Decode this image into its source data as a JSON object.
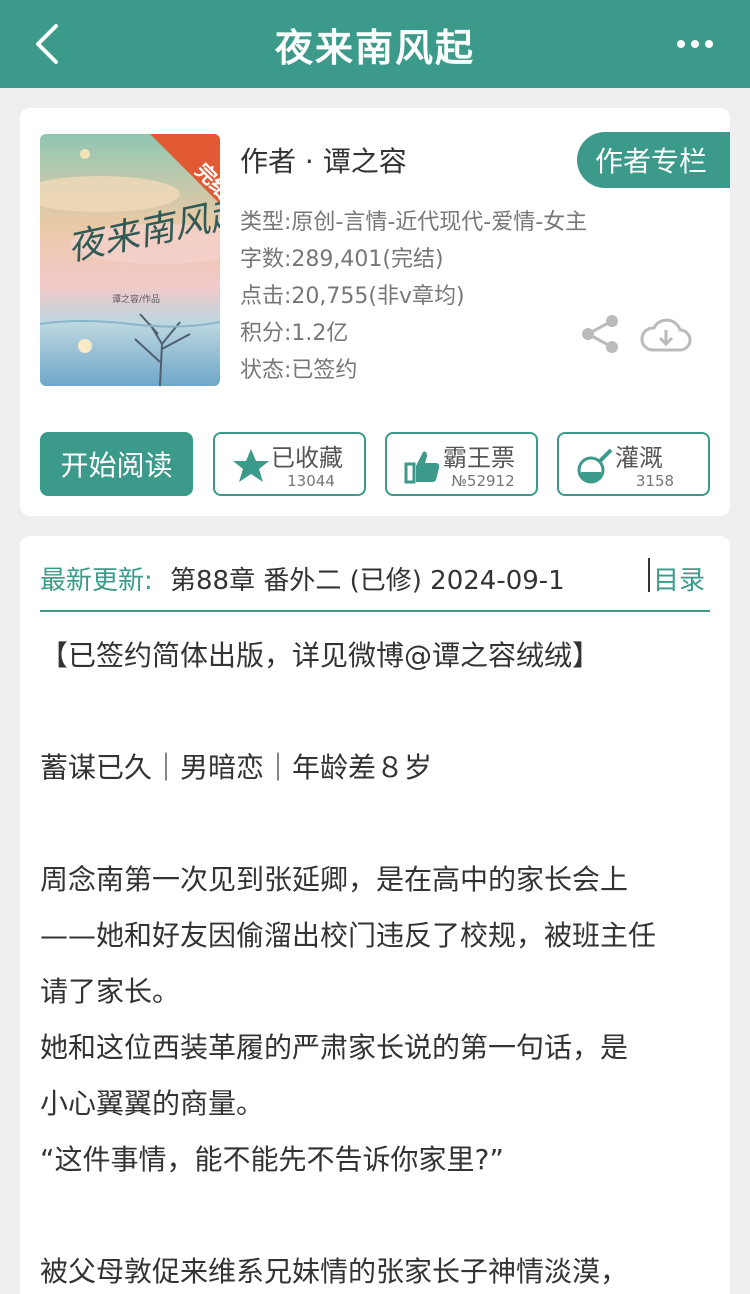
{
  "header": {
    "title": "夜来南风起"
  },
  "book": {
    "cover_badge": "完结",
    "cover_title": "夜来南风起",
    "cover_author_line": "谭之容/作品",
    "author_line": "作者 · 谭之容",
    "author_column_label": "作者专栏",
    "meta": {
      "type": "类型:原创-言情-近代现代-爱情-女主",
      "words": "字数:289,401(完结)",
      "clicks": "点击:20,755(非v章均)",
      "points": "积分:1.2亿",
      "status": "状态:已签约"
    }
  },
  "actions": {
    "read_label": "开始阅读",
    "favorite": {
      "label": "已收藏",
      "count": "13044"
    },
    "ticket": {
      "label": "霸王票",
      "count": "№52912"
    },
    "nourish": {
      "label": "灌溉",
      "count": "3158"
    }
  },
  "update": {
    "label": "最新更新:",
    "text": "第88章 番外二 (已修) 2024-09-1",
    "toc_label": "目录"
  },
  "synopsis": [
    "【已签约简体出版，详见微博@谭之容绒绒】",
    "",
    "蓄谋已久｜男暗恋｜年龄差８岁",
    "",
    "周念南第一次见到张延卿，是在高中的家长会上",
    "——她和好友因偷溜出校门违反了校规，被班主任",
    "请了家长。",
    "她和这位西装革履的严肃家长说的第一句话，是",
    "小心翼翼的商量。",
    "“这件事情，能不能先不告诉你家里?”",
    "",
    "被父母敦促来维系兄妹情的张家长子神情淡漠，"
  ],
  "colors": {
    "accent": "#3c9a8a",
    "background": "#efefef"
  }
}
